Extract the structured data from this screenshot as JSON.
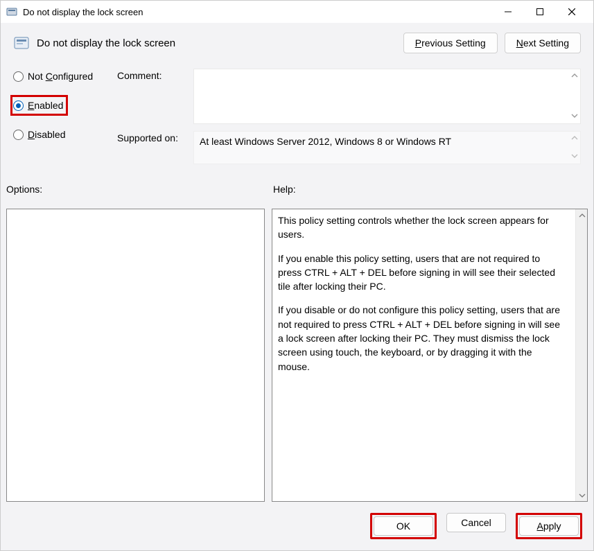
{
  "window": {
    "title": "Do not display the lock screen"
  },
  "toolbar": {
    "title": "Do not display the lock screen",
    "previous": "Previous Setting",
    "next": "Next Setting"
  },
  "radios": {
    "not_configured": "Not Configured",
    "enabled": "Enabled",
    "disabled": "Disabled",
    "selected": "enabled"
  },
  "meta": {
    "comment_label": "Comment:",
    "comment_value": "",
    "supported_label": "Supported on:",
    "supported_value": "At least Windows Server 2012, Windows 8 or Windows RT"
  },
  "sections": {
    "options": "Options:",
    "help": "Help:"
  },
  "help": {
    "p1": "This policy setting controls whether the lock screen appears for users.",
    "p2": "If you enable this policy setting, users that are not required to press CTRL + ALT + DEL before signing in will see their selected tile after locking their PC.",
    "p3": "If you disable or do not configure this policy setting, users that are not required to press CTRL + ALT + DEL before signing in will see a lock screen after locking their PC. They must dismiss the lock screen using touch, the keyboard, or by dragging it with the mouse."
  },
  "buttons": {
    "ok": "OK",
    "cancel": "Cancel",
    "apply": "Apply"
  }
}
